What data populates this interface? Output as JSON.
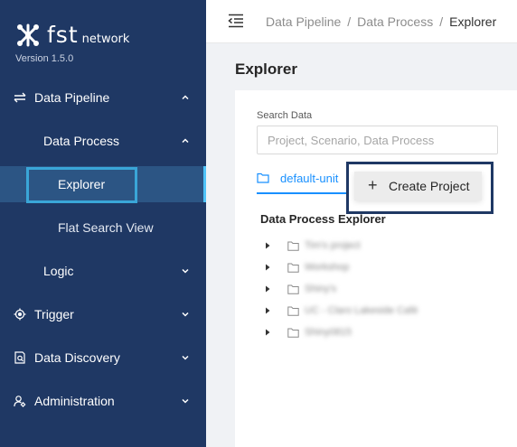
{
  "app": {
    "logo_text": "fst",
    "logo_subtext": "network",
    "version": "Version 1.5.0"
  },
  "sidebar": {
    "items": [
      {
        "label": "Data Pipeline",
        "icon": "pipeline-icon",
        "expanded": true
      },
      {
        "label": "Data Process",
        "expanded": true
      },
      {
        "label": "Explorer",
        "selected": true
      },
      {
        "label": "Flat Search View"
      },
      {
        "label": "Logic",
        "expanded": false
      },
      {
        "label": "Trigger",
        "icon": "trigger-icon",
        "expanded": false
      },
      {
        "label": "Data Discovery",
        "icon": "data-discovery-icon",
        "expanded": false
      },
      {
        "label": "Administration",
        "icon": "administration-icon",
        "expanded": false
      }
    ]
  },
  "header": {
    "breadcrumb": [
      "Data Pipeline",
      "Data Process",
      "Explorer"
    ],
    "separator": "/"
  },
  "main": {
    "title": "Explorer",
    "search": {
      "label": "Search Data",
      "placeholder": "Project, Scenario, Data Process",
      "value": ""
    },
    "tab": {
      "label": "default-unit"
    },
    "create_button": {
      "label": "Create Project",
      "icon": "plus-icon"
    },
    "tree": {
      "title": "Data Process Explorer",
      "items": [
        {
          "label": "Tim's project"
        },
        {
          "label": "Workshop"
        },
        {
          "label": "Shiny's"
        },
        {
          "label": "UC - Claro Lakeside Café"
        },
        {
          "label": "Shiny0815"
        }
      ]
    }
  },
  "colors": {
    "sidebar_bg": "#1f3864",
    "selected_bg": "#2c5584",
    "accent": "#1890ff",
    "highlight_border": "#3aa6d8"
  }
}
